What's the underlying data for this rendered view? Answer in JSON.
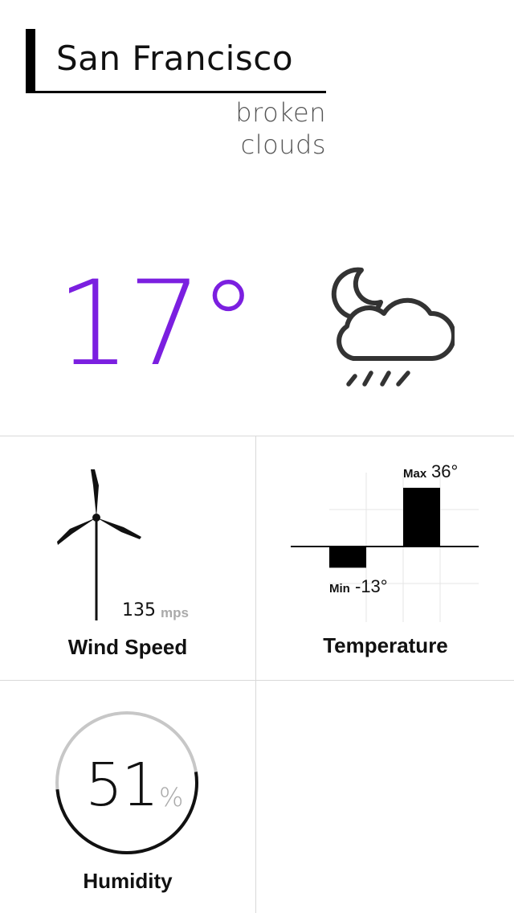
{
  "location": {
    "city": "San Francisco",
    "condition": "broken clouds"
  },
  "current": {
    "temperature": "17°",
    "temperature_color": "#7b1fe0",
    "icon": "moon-cloud-rain-icon"
  },
  "tiles": {
    "wind": {
      "value": "135",
      "unit": "mps",
      "label": "Wind Speed",
      "icon": "wind-turbine-icon"
    },
    "temperature": {
      "label": "Temperature",
      "max_label": "Max",
      "max_value": "36°",
      "min_label": "Min",
      "min_value": "-13°"
    },
    "humidity": {
      "value": "51",
      "unit": "%",
      "label": "Humidity",
      "level": 0.51
    }
  },
  "chart_data": {
    "type": "bar",
    "categories": [
      "Min",
      "Max"
    ],
    "values": [
      -13,
      36
    ],
    "ylim": [
      -40,
      40
    ]
  }
}
